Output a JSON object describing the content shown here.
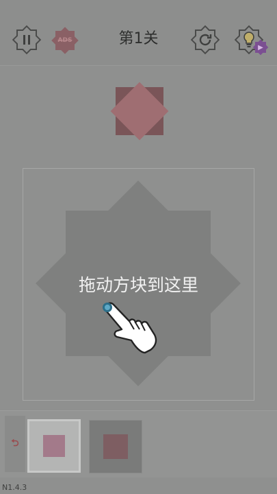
{
  "header": {
    "level_title": "第1关",
    "ads_label": "ADS",
    "pause_icon": "pause-icon",
    "restart_icon": "restart-icon",
    "hint_icon": "lightbulb-icon",
    "hint_badge_icon": "video-icon"
  },
  "board": {
    "instruction": "拖动方块到这里"
  },
  "tray": {
    "undo_glyph": "⮌"
  },
  "footer": {
    "version": "N1.4.3"
  },
  "colors": {
    "background": "#8f908f",
    "target_pink": "#9f6e72",
    "piece_pink": "#a37a8a",
    "hint_purple": "#7b4f92",
    "tap_blue": "#5ea9c7"
  }
}
